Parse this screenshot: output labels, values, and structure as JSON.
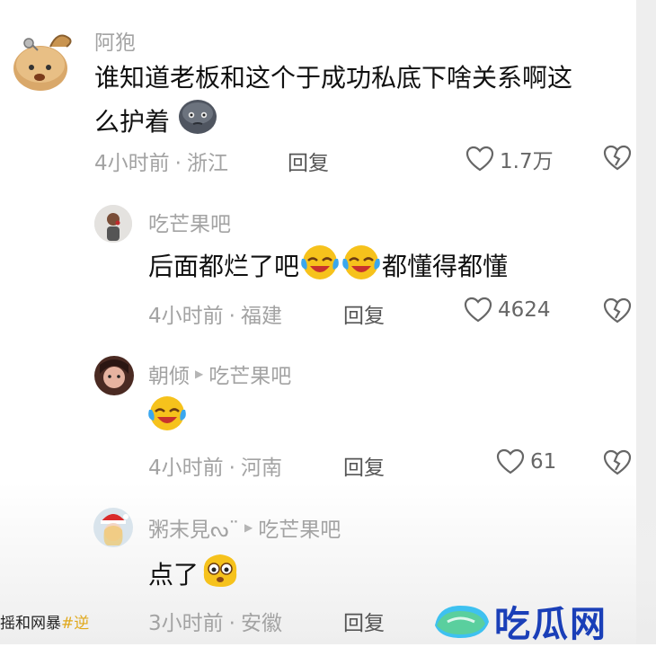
{
  "comments": [
    {
      "author": "阿狍",
      "text_line1": "谁知道老板和这个于成功私底下啥关系啊这",
      "text_line2": "么护着",
      "time": "4小时前",
      "location": "浙江",
      "reply_label": "回复",
      "likes": "1.7万"
    },
    {
      "author": "吃芒果吧",
      "text_before": "后面都烂了吧",
      "text_after": "都懂得都懂",
      "time": "4小时前",
      "location": "福建",
      "reply_label": "回复",
      "likes": "4624"
    },
    {
      "author": "朝倾",
      "reply_to": "吃芒果吧",
      "time": "4小时前",
      "location": "河南",
      "reply_label": "回复",
      "likes": "61"
    },
    {
      "author": "粥末見ᔓ¨",
      "reply_to": "吃芒果吧",
      "text_before": "点了",
      "time": "3小时前",
      "location": "安徽",
      "reply_label": "回复"
    }
  ],
  "ticker": {
    "text": "摇和网暴",
    "tag": "#逆"
  },
  "watermark": {
    "text": "吃瓜网"
  },
  "colors": {
    "watermark_blue": "#1a3fb8",
    "muted_gray": "#a3a3a3",
    "text_black": "#111111"
  }
}
